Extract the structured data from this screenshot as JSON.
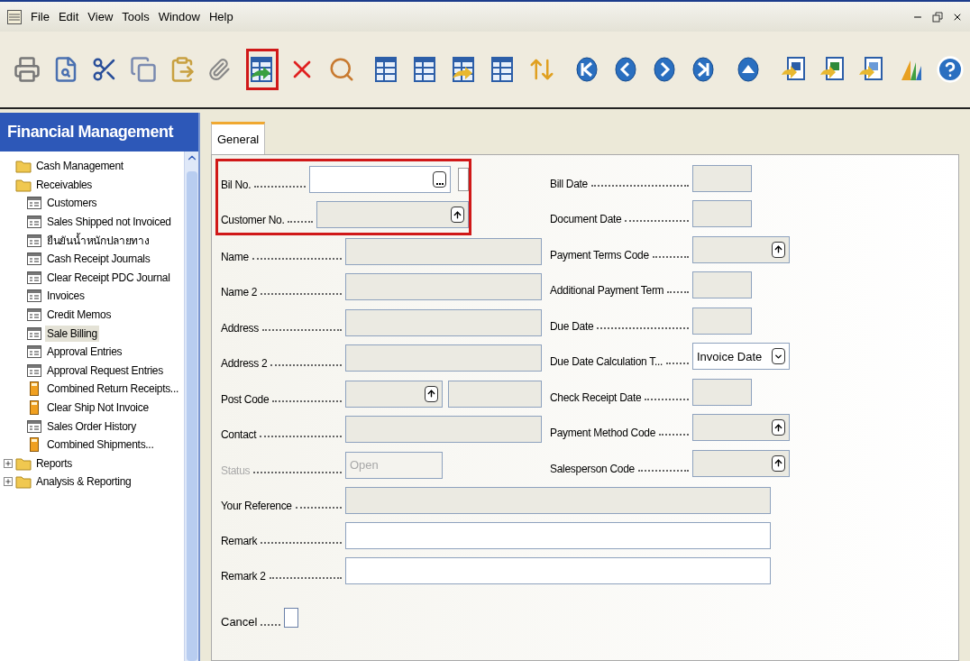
{
  "menu": [
    "File",
    "Edit",
    "View",
    "Tools",
    "Window",
    "Help"
  ],
  "toolbar": [
    {
      "kind": "print",
      "highlighted": false
    },
    {
      "kind": "preview",
      "highlighted": false
    },
    {
      "kind": "cut",
      "highlighted": false
    },
    {
      "kind": "copy",
      "highlighted": false
    },
    {
      "kind": "paste",
      "highlighted": false
    },
    {
      "kind": "attach",
      "highlighted": false
    },
    {
      "kind": "gap"
    },
    {
      "kind": "table-arrow",
      "highlighted": true
    },
    {
      "kind": "delete",
      "highlighted": false
    },
    {
      "kind": "find",
      "highlighted": false
    },
    {
      "kind": "gap"
    },
    {
      "kind": "table",
      "highlighted": false
    },
    {
      "kind": "table",
      "highlighted": false
    },
    {
      "kind": "table-arrow-yellow",
      "highlighted": false
    },
    {
      "kind": "table",
      "highlighted": false
    },
    {
      "kind": "sort",
      "highlighted": false
    },
    {
      "kind": "gap"
    },
    {
      "kind": "first",
      "highlighted": false
    },
    {
      "kind": "prev",
      "highlighted": false
    },
    {
      "kind": "next",
      "highlighted": false
    },
    {
      "kind": "last",
      "highlighted": false
    },
    {
      "kind": "gap"
    },
    {
      "kind": "up",
      "highlighted": false
    },
    {
      "kind": "gap"
    },
    {
      "kind": "word",
      "highlighted": false
    },
    {
      "kind": "excel",
      "highlighted": false
    },
    {
      "kind": "approve",
      "highlighted": false
    }
  ],
  "sidebar": {
    "title": "Financial Management",
    "items": [
      {
        "label": "Cash Management",
        "kind": "folder",
        "expandable": false,
        "selected": false
      },
      {
        "label": "Receivables",
        "kind": "folder",
        "expandable": false,
        "selected": false,
        "children": [
          {
            "label": "Customers",
            "kind": "form",
            "selected": false
          },
          {
            "label": "Sales Shipped not Invoiced",
            "kind": "form",
            "selected": false
          },
          {
            "label": "ยืนยันน้ำหนักปลายทาง",
            "kind": "form",
            "selected": false
          },
          {
            "label": "Cash Receipt Journals",
            "kind": "form",
            "selected": false
          },
          {
            "label": "Clear Receipt PDC Journal",
            "kind": "form",
            "selected": false
          },
          {
            "label": "Invoices",
            "kind": "form",
            "selected": false
          },
          {
            "label": "Credit Memos",
            "kind": "form",
            "selected": false
          },
          {
            "label": "Sale Billing",
            "kind": "form",
            "selected": true
          },
          {
            "label": "Approval Entries",
            "kind": "form",
            "selected": false
          },
          {
            "label": "Approval Request Entries",
            "kind": "form",
            "selected": false
          },
          {
            "label": "Combined Return Receipts...",
            "kind": "report",
            "selected": false
          },
          {
            "label": "Clear Ship Not Invoice",
            "kind": "report",
            "selected": false
          },
          {
            "label": "Sales Order History",
            "kind": "form",
            "selected": false
          },
          {
            "label": "Combined Shipments...",
            "kind": "report",
            "selected": false
          }
        ]
      },
      {
        "label": "Reports",
        "kind": "folder",
        "expandable": true,
        "selected": false
      },
      {
        "label": "Analysis & Reporting",
        "kind": "folder",
        "expandable": true,
        "selected": false
      }
    ]
  },
  "tabs": [
    {
      "label": "General",
      "selected": true
    }
  ],
  "form": {
    "left": [
      {
        "label": "Bil No.",
        "kind": "assist",
        "editable": true,
        "highlighted": true
      },
      {
        "label": "Customer No.",
        "kind": "lookup",
        "editable": false,
        "highlighted": true
      },
      {
        "label": "Name",
        "kind": "text",
        "editable": false,
        "highlighted": false
      },
      {
        "label": "Name 2",
        "kind": "text",
        "editable": false,
        "highlighted": false
      },
      {
        "label": "Address",
        "kind": "text",
        "editable": false,
        "highlighted": false
      },
      {
        "label": "Address 2",
        "kind": "text",
        "editable": false,
        "highlighted": false
      },
      {
        "label": "Post Code",
        "kind": "split",
        "editable": false,
        "highlighted": false
      },
      {
        "label": "Contact",
        "kind": "text",
        "editable": false,
        "highlighted": false
      },
      {
        "label": "Status",
        "kind": "short",
        "editable": false,
        "disabled": true,
        "value": "Open",
        "highlighted": false
      }
    ],
    "right": [
      {
        "label": "Bill Date",
        "kind": "short",
        "editable": false
      },
      {
        "label": "Document Date",
        "kind": "short",
        "editable": false
      },
      {
        "label": "Payment Terms Code",
        "kind": "lookup",
        "editable": false
      },
      {
        "label": "Additional Payment Term",
        "kind": "short",
        "editable": false
      },
      {
        "label": "Due Date",
        "kind": "short",
        "editable": false
      },
      {
        "label": "Due Date Calculation T...",
        "kind": "dropdown",
        "editable": true,
        "value": "Invoice Date"
      },
      {
        "label": "Check Receipt Date",
        "kind": "short",
        "editable": false
      },
      {
        "label": "Payment Method Code",
        "kind": "lookup",
        "editable": false
      },
      {
        "label": "Salesperson Code",
        "kind": "lookup",
        "editable": false
      }
    ],
    "wide": [
      {
        "label": "Your Reference",
        "editable": false
      },
      {
        "label": "Remark",
        "editable": true
      },
      {
        "label": "Remark 2",
        "editable": true
      }
    ],
    "checkbox": {
      "label": "Cancel",
      "checked": false
    }
  }
}
